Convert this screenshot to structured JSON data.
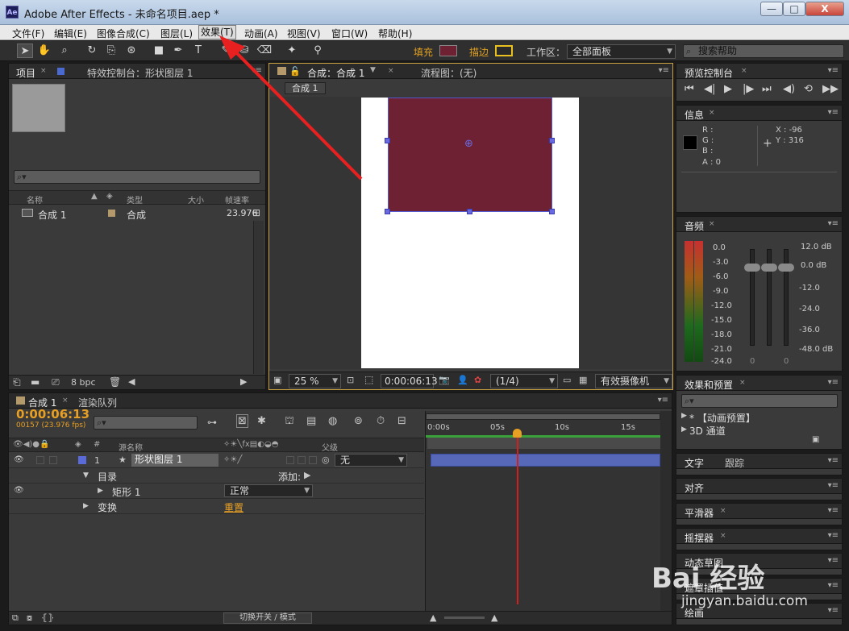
{
  "window": {
    "title": "Adobe After Effects - 未命名项目.aep *",
    "logo": "Ae",
    "minimize": "—",
    "maximize": "□",
    "close": "X"
  },
  "menu": [
    "文件(F)",
    "编辑(E)",
    "图像合成(C)",
    "图层(L)",
    "效果(T)",
    "动画(A)",
    "视图(V)",
    "窗口(W)",
    "帮助(H)"
  ],
  "toolbar": {
    "fill_label": "填充",
    "stroke_label": "描边",
    "workspace_label": "工作区：",
    "workspace_value": "全部面板",
    "search_placeholder": "搜索帮助",
    "fill_color": "#6e2133",
    "stroke_color": "#e8c020"
  },
  "project_panel": {
    "tab_project": "项目",
    "tab_effects": "特效控制台：形状图层 1",
    "columns": [
      "名称",
      "类型",
      "大小",
      "帧速率"
    ],
    "item": {
      "name": "合成 1",
      "type": "合成",
      "fps": "23.976"
    },
    "bpc": "8 bpc"
  },
  "comp_panel": {
    "tab_comp": "合成：合成 1",
    "tab_flow": "流程图：(无)",
    "sub_tab": "合成 1",
    "zoom": "25 %",
    "timecode": "0:00:06:13",
    "resolution": "(1/4)",
    "camera": "有效摄像机"
  },
  "preview_panel": {
    "tab": "预览控制台"
  },
  "info_panel": {
    "tab": "信息",
    "r": "R :",
    "g": "G :",
    "b": "B :",
    "a": "A : 0",
    "x": "X : -96",
    "y": "Y : 316"
  },
  "audio_panel": {
    "tab": "音频",
    "left_scale": [
      "0.0",
      "-3.0",
      "-6.0",
      "-9.0",
      "-12.0",
      "-15.0",
      "-18.0",
      "-21.0",
      "-24.0"
    ],
    "right_scale": [
      "12.0 dB",
      "0.0 dB",
      "-12.0",
      "-24.0",
      "-36.0",
      "-48.0 dB"
    ],
    "fader_zero_1": "0",
    "fader_zero_2": "0"
  },
  "effects_panel": {
    "tab": "效果和预置",
    "item1": "* 【动画预置】",
    "item2": "3D 通道"
  },
  "side_panels": {
    "text": "文字",
    "paragraph": "跟踪",
    "align": "对齐",
    "smoother": "平滑器",
    "wiggler": "摇摆器",
    "motion_sketch": "动态草图",
    "mask_interp": "遮罩插值",
    "paint": "绘画"
  },
  "timeline": {
    "tab_comp": "合成 1",
    "tab_render": "渲染队列",
    "timecode": "0:00:06:13",
    "fps": "00157 (23.976 fps)",
    "col_source": "源名称",
    "col_parent": "父级",
    "layer_num": "1",
    "layer_name": "形状图层 1",
    "parent_value": "无",
    "contents": "目录",
    "add_label": "添加:",
    "rect": "矩形 1",
    "blend": "正常",
    "transform": "变换",
    "reset": "重置",
    "ruler": [
      "0:00s",
      "05s",
      "10s",
      "15s"
    ],
    "toggle": "切换开关 / 模式"
  },
  "watermark": {
    "brand": "Bai 经验",
    "url": "jingyan.baidu.com"
  }
}
